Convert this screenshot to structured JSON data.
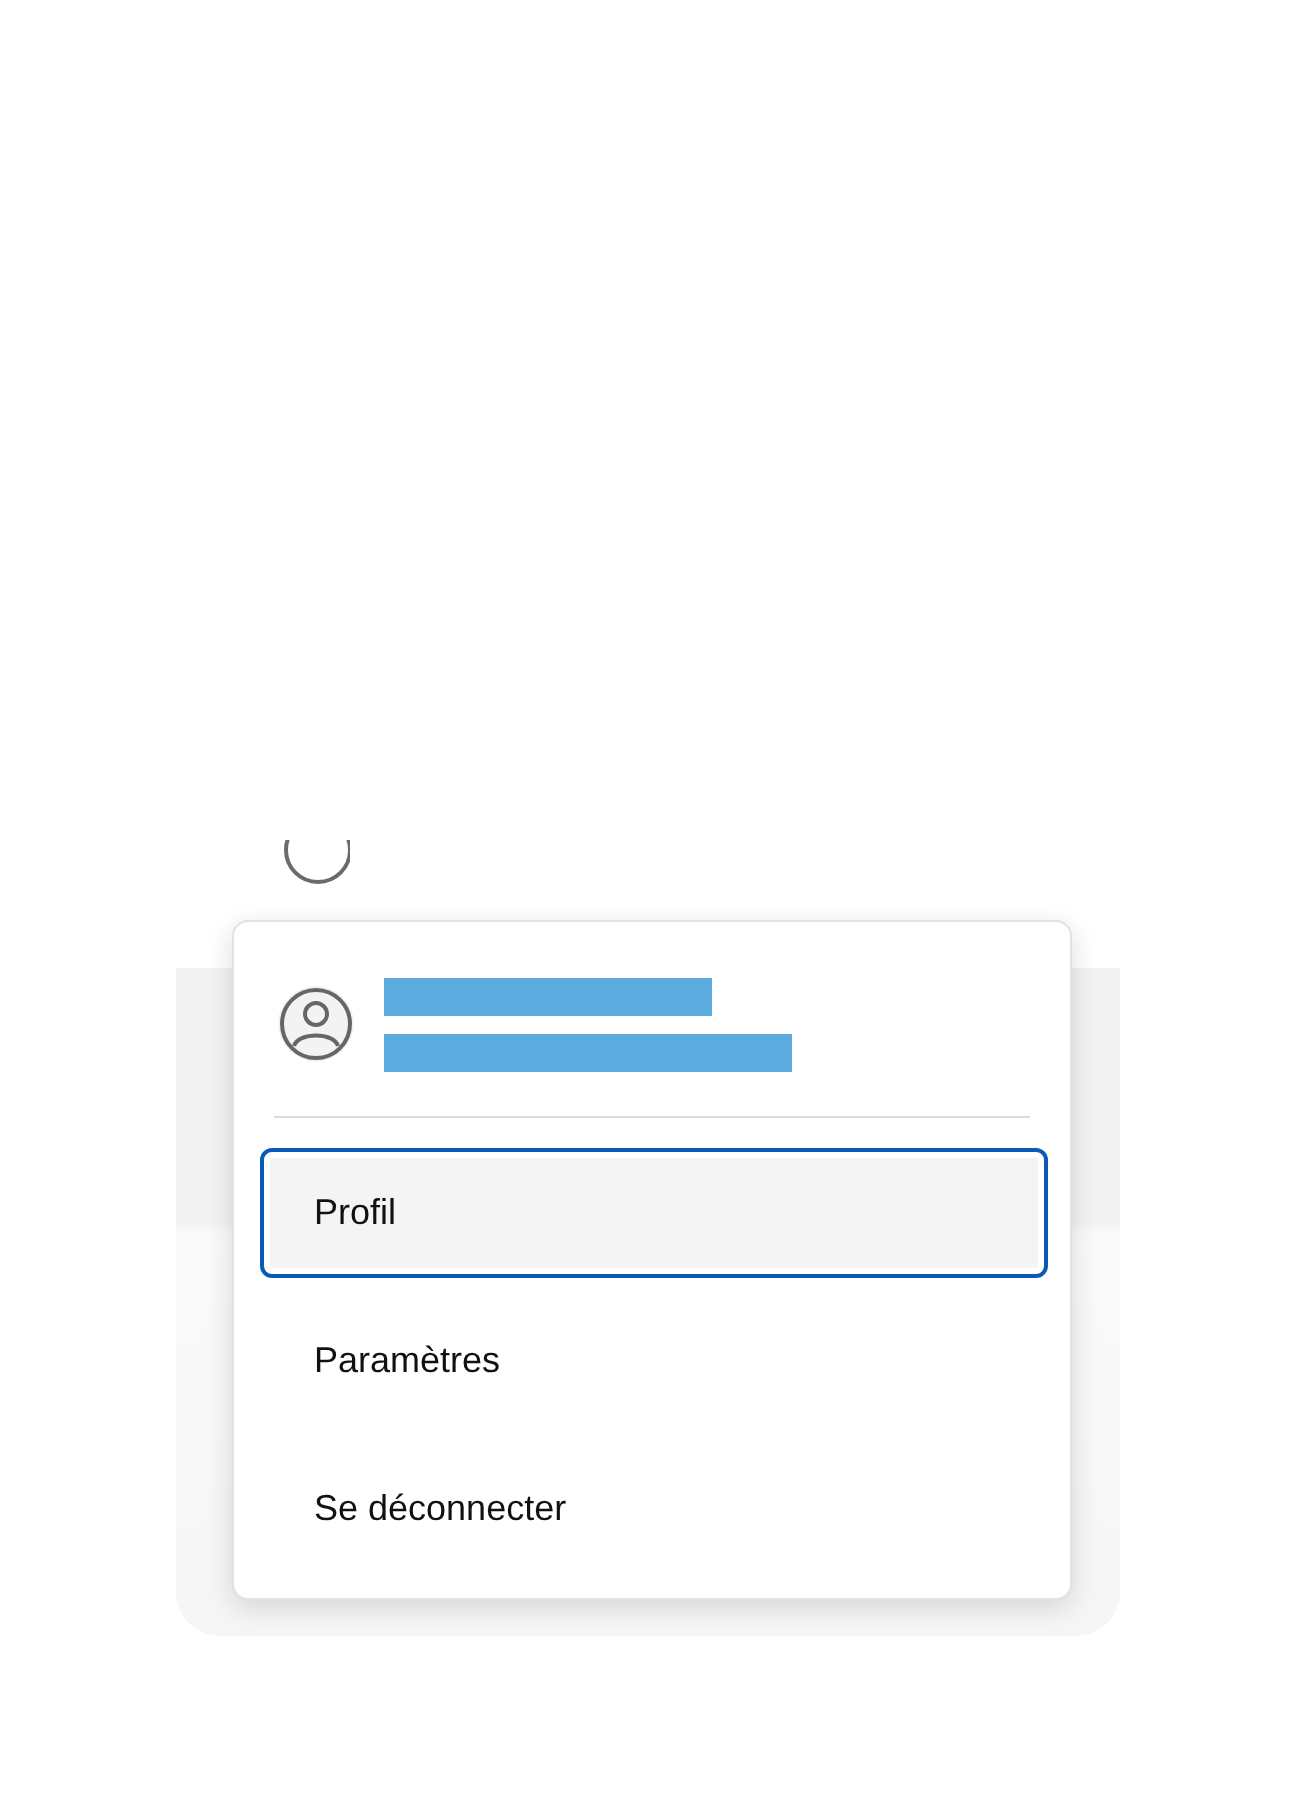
{
  "account": {
    "redacted": true
  },
  "menu": {
    "items": [
      {
        "label": "Profil",
        "selected": true
      },
      {
        "label": "Paramètres",
        "selected": false
      },
      {
        "label": "Se déconnecter",
        "selected": false
      }
    ]
  }
}
